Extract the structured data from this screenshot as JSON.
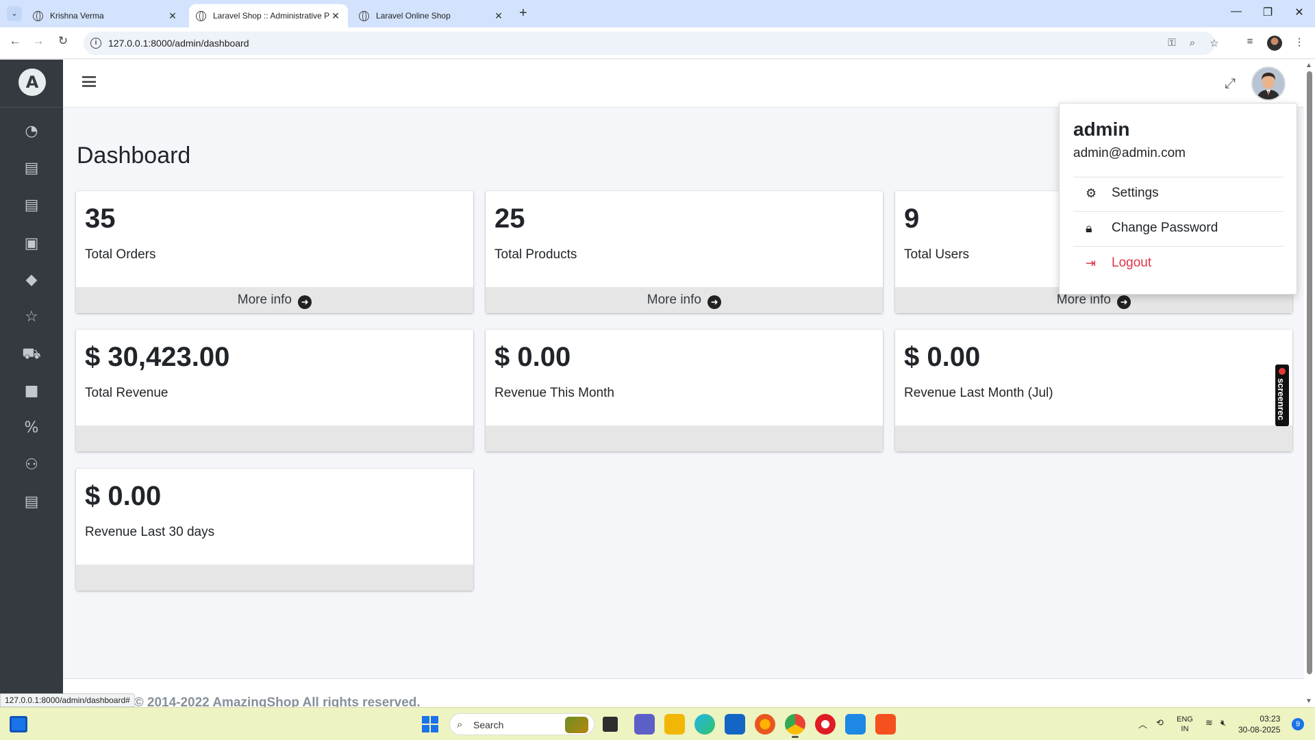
{
  "browser": {
    "tabs": [
      {
        "title": "Krishna Verma",
        "active": false
      },
      {
        "title": "Laravel Shop :: Administrative P",
        "active": true
      },
      {
        "title": "Laravel Online Shop",
        "active": false
      }
    ],
    "url": "127.0.0.1:8000/admin/dashboard",
    "status_url": "127.0.0.1:8000/admin/dashboard#"
  },
  "sidebar": {
    "brand_icon": "A",
    "items": [
      {
        "name": "dashboard",
        "icon": "gauge-icon"
      },
      {
        "name": "categories",
        "icon": "file-icon"
      },
      {
        "name": "sub-categories",
        "icon": "file-alt-icon"
      },
      {
        "name": "brands",
        "icon": "book-icon"
      },
      {
        "name": "products",
        "icon": "tag-icon"
      },
      {
        "name": "ratings",
        "icon": "star-icon"
      },
      {
        "name": "shipping",
        "icon": "truck-icon"
      },
      {
        "name": "orders",
        "icon": "shopping-bag-icon"
      },
      {
        "name": "discount",
        "icon": "percent-icon"
      },
      {
        "name": "users",
        "icon": "users-icon"
      },
      {
        "name": "pages",
        "icon": "file-lines-icon"
      }
    ]
  },
  "page": {
    "title": "Dashboard"
  },
  "cards": [
    {
      "value": "35",
      "label": "Total Orders",
      "footer": "More info"
    },
    {
      "value": "25",
      "label": "Total Products",
      "footer": "More info"
    },
    {
      "value": "9",
      "label": "Total Users",
      "footer": "More info"
    },
    {
      "value": "$ 30,423.00",
      "label": "Total Revenue",
      "footer": ""
    },
    {
      "value": "$ 0.00",
      "label": "Revenue This Month",
      "footer": ""
    },
    {
      "value": "$ 0.00",
      "label": "Revenue Last Month (Jul)",
      "footer": ""
    },
    {
      "value": "$ 0.00",
      "label": "Revenue Last 30 days",
      "footer": ""
    }
  ],
  "dropdown": {
    "name": "admin",
    "email": "admin@admin.com",
    "items": [
      "Settings",
      "Change Password",
      "Logout"
    ]
  },
  "footer": {
    "text": "t © 2014-2022 AmazingShop All rights reserved."
  },
  "screenrec": {
    "label": "screenrec"
  },
  "taskbar": {
    "search_placeholder": "Search",
    "lang": "ENG",
    "region": "IN",
    "time": "03:23",
    "date": "30-08-2025",
    "notifications": "9"
  },
  "colors": {
    "sidebar_bg": "#343a40",
    "logout_red": "#dc3545",
    "card_footer": "#e6e6e6",
    "tabstrip": "#d3e3fd",
    "taskbar": "#eef3c2"
  }
}
